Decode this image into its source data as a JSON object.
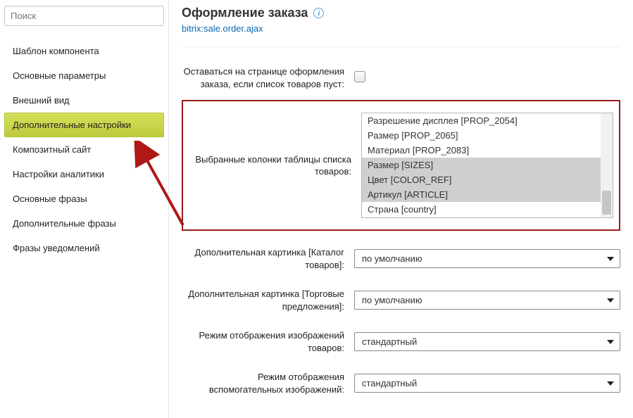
{
  "sidebar": {
    "search_placeholder": "Поиск",
    "items": [
      {
        "label": "Шаблон компонента",
        "active": false
      },
      {
        "label": "Основные параметры",
        "active": false
      },
      {
        "label": "Внешний вид",
        "active": false
      },
      {
        "label": "Дополнительные настройки",
        "active": true
      },
      {
        "label": "Композитный сайт",
        "active": false
      },
      {
        "label": "Настройки аналитики",
        "active": false
      },
      {
        "label": "Основные фразы",
        "active": false
      },
      {
        "label": "Дополнительные фразы",
        "active": false
      },
      {
        "label": "Фразы уведомлений",
        "active": false
      }
    ]
  },
  "header": {
    "title": "Оформление заказа",
    "component": "bitrix:sale.order.ajax"
  },
  "form": {
    "stay_on_page_label": "Оставаться на странице оформления заказа, если список товаров пуст:",
    "columns_label": "Выбранные колонки таблицы списка товаров:",
    "column_options": [
      {
        "text": "Разрешение дисплея [PROP_2054]",
        "selected": false
      },
      {
        "text": "Размер [PROP_2065]",
        "selected": false
      },
      {
        "text": "Материал [PROP_2083]",
        "selected": false
      },
      {
        "text": "Размер [SIZES]",
        "selected": true
      },
      {
        "text": "Цвет [COLOR_REF]",
        "selected": true
      },
      {
        "text": "Артикул [ARTICLE]",
        "selected": true
      },
      {
        "text": "Страна [country]",
        "selected": false
      }
    ],
    "catalog_img_label": "Дополнительная картинка [Каталог товаров]:",
    "catalog_img_value": "по умолчанию",
    "offers_img_label": "Дополнительная картинка [Торговые предложения]:",
    "offers_img_value": "по умолчанию",
    "img_mode_label": "Режим отображения изображений товаров:",
    "img_mode_value": "стандартный",
    "aux_img_mode_label": "Режим отображения вспомогательных изображений:",
    "aux_img_mode_value": "стандартный"
  }
}
